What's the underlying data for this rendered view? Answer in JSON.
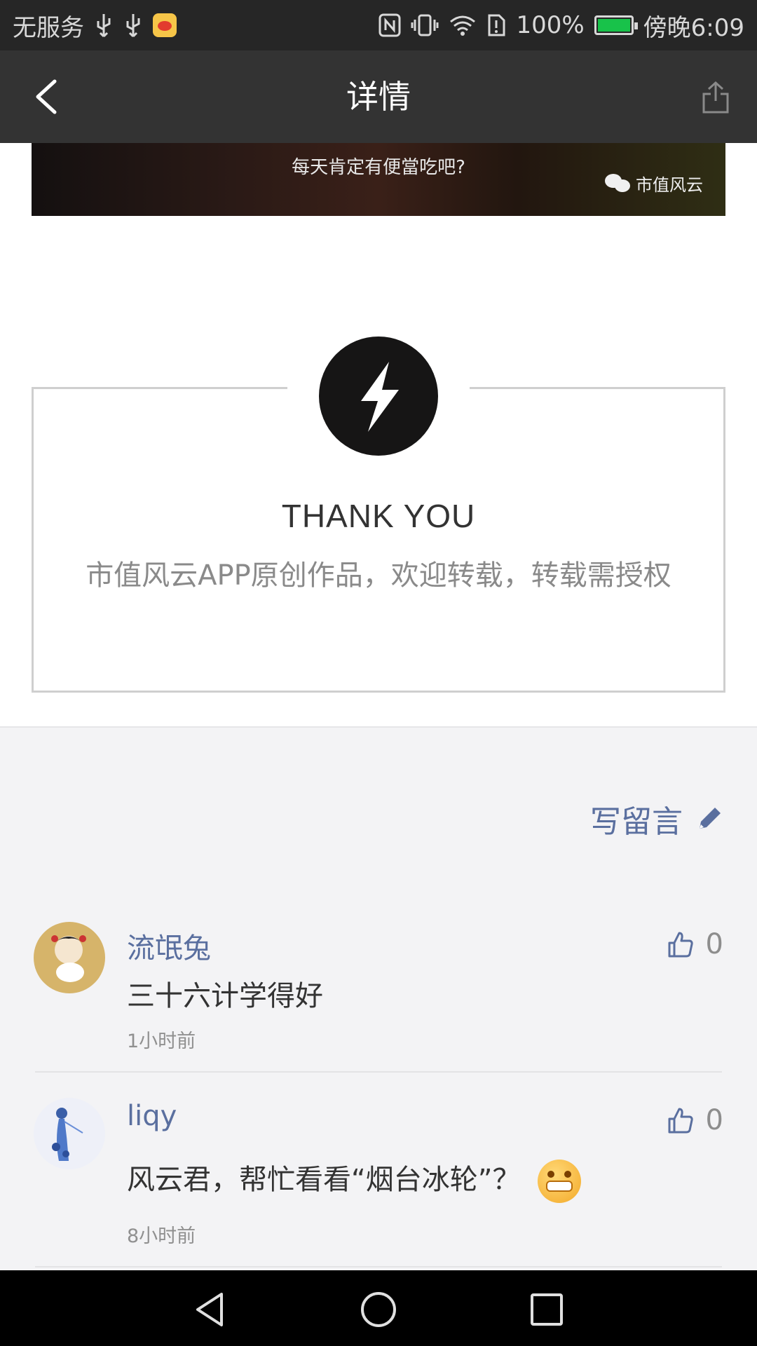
{
  "status_bar": {
    "carrier": "无服务",
    "battery": "100%",
    "time": "傍晚6:09",
    "icons": [
      "usb-icon",
      "usb-icon",
      "weibo-icon",
      "nfc-icon",
      "vibrate-icon",
      "wifi-icon",
      "sim-alert-icon",
      "battery-icon"
    ]
  },
  "navbar": {
    "title": "详情",
    "back_icon": "chevron-left-icon",
    "share_icon": "share-icon"
  },
  "article": {
    "image_caption": "每天肯定有便當吃吧?",
    "watermark": "市值风云",
    "thanks_title": "THANK YOU",
    "thanks_text": "市值风云APP原创作品，欢迎转载，转载需授权",
    "badge_icon": "lightning-icon"
  },
  "comments": {
    "write_label": "写留言",
    "write_icon": "pencil-icon",
    "items": [
      {
        "name": "流氓兔",
        "text": "三十六计学得好",
        "time": "1小时前",
        "likes": "0"
      },
      {
        "name": "liqy",
        "text": "风云君，帮忙看看“烟台冰轮”？",
        "time": "8小时前",
        "likes": "0"
      }
    ]
  },
  "system_nav": {
    "back": "back-triangle-icon",
    "home": "home-circle-icon",
    "recents": "recents-square-icon"
  },
  "colors": {
    "navbar": "#333333",
    "accent_link": "#5a6f9f",
    "battery_fill": "#18c24a"
  }
}
